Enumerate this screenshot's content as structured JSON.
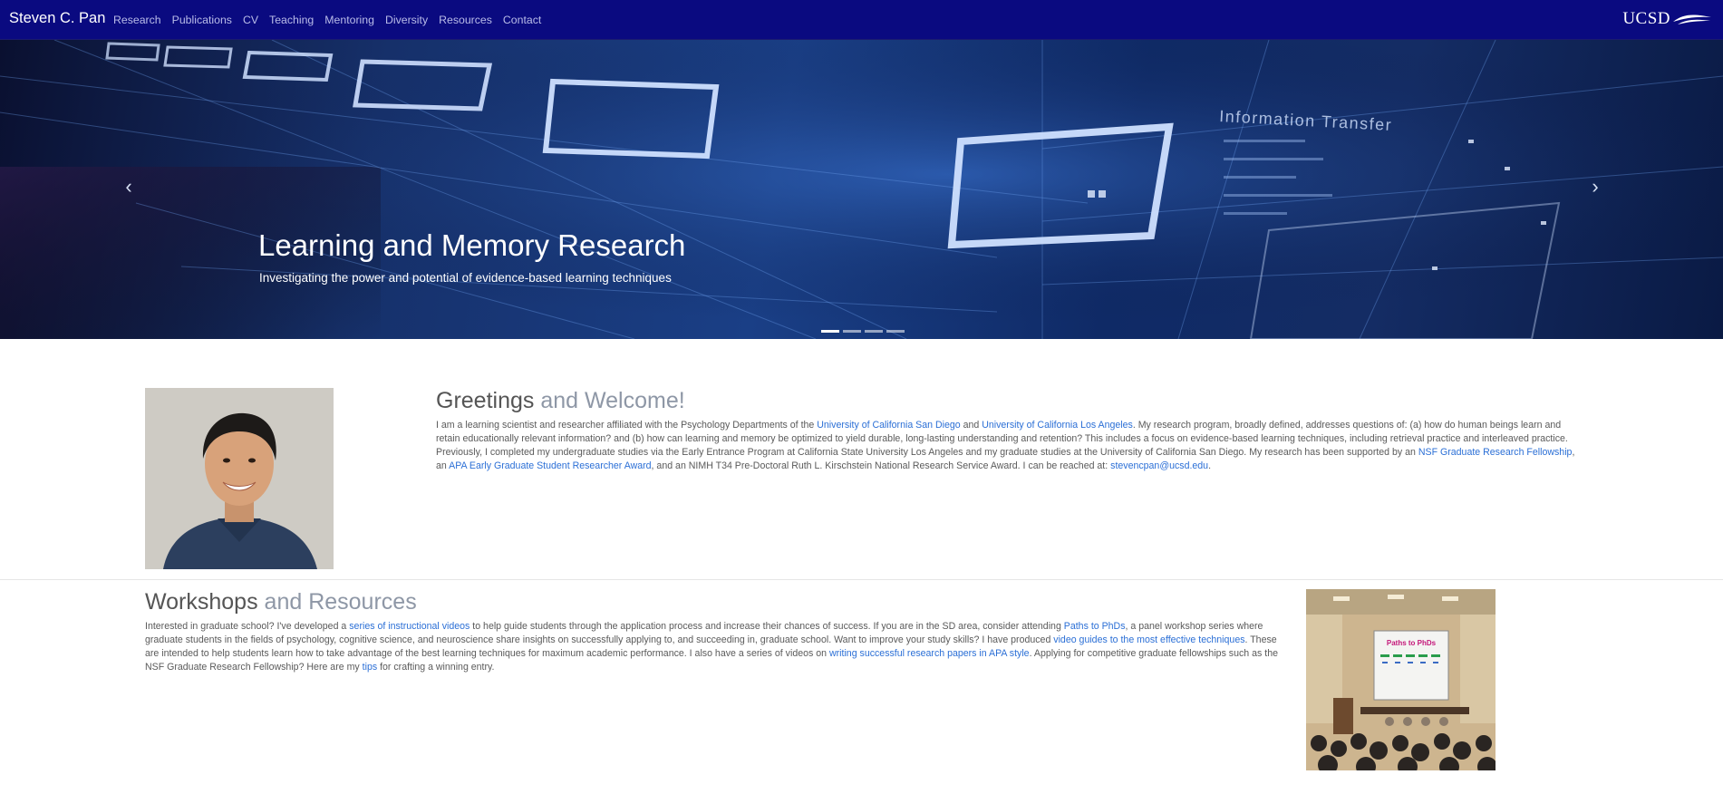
{
  "navbar": {
    "brand": "Steven C. Pan",
    "links": [
      "Research",
      "Publications",
      "CV",
      "Teaching",
      "Mentoring",
      "Diversity",
      "Resources",
      "Contact"
    ],
    "logo_text": "UCSD"
  },
  "hero": {
    "title": "Learning and Memory Research",
    "subtitle": "Investigating the power and potential of evidence-based learning techniques",
    "image_text": "Information Transfer",
    "slide_count": 4,
    "active_slide": 1,
    "prev_icon": "chevron-left-icon",
    "next_icon": "chevron-right-icon"
  },
  "greetings": {
    "title_strong": "Greetings",
    "title_muted": " and Welcome!",
    "p1": "I am a learning scientist and researcher affiliated with the Psychology Departments of the ",
    "link_ucsd": "University of California San Diego",
    "p2": " and ",
    "link_ucla": "University of California Los Angeles",
    "p3": ". My research program, broadly defined, addresses questions of: (a) how do human beings learn and retain educationally relevant information? and (b) how can learning and memory be optimized to yield durable, long-lasting understanding and retention? This includes a focus on evidence-based learning techniques, including retrieval practice and interleaved practice. Previously, I completed my undergraduate studies via the Early Entrance Program at California State University Los Angeles and my graduate studies at the University of California San Diego. My research has been supported by an ",
    "link_nsf": "NSF Graduate Research Fellowship",
    "p4": ", an ",
    "link_apa": "APA Early Graduate Student Researcher Award",
    "p5": ", and an NIMH T34 Pre-Doctoral Ruth L. Kirschstein National Research Service Award. I can be reached at: ",
    "link_email": "stevencpan@ucsd.edu",
    "p6": "."
  },
  "workshops": {
    "title_strong": "Workshops",
    "title_muted": " and Resources",
    "p1": "Interested in graduate school? I've developed a ",
    "link_videos": "series of instructional videos",
    "p2": " to help guide students through the application process and increase their chances of success. If you are in the SD area, consider attending ",
    "link_paths": "Paths to PhDs",
    "p3": ", a panel workshop series where graduate students in the fields of psychology, cognitive science, and neuroscience share insights on successfully applying to, and succeeding in, graduate school. Want to improve your study skills? I have produced ",
    "link_guides": "video guides to the most effective techniques",
    "p4": ". These are intended to help students learn how to take advantage of the best learning techniques for maximum academic performance. I also have a series of videos on ",
    "link_apa": "writing successful research papers in APA style",
    "p5": ". Applying for competitive graduate fellowships such as the NSF Graduate Research Fellowship? Here are my ",
    "link_tips": "tips",
    "p6": " for crafting a winning entry.",
    "photo_slide_title": "Paths to PhDs"
  },
  "colors": {
    "navbar_bg": "#0a0a80",
    "link": "#2b6fd6",
    "heading": "#555555",
    "heading_muted": "#8e97a6"
  }
}
